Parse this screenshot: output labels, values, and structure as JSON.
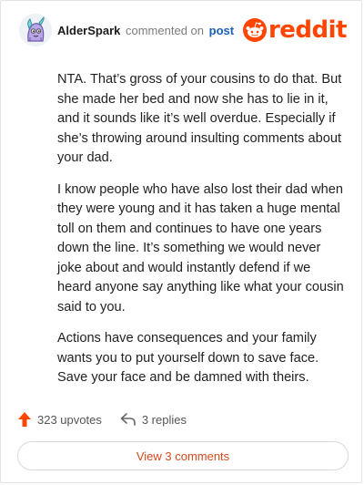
{
  "header": {
    "username": "AlderSpark",
    "action_text": "commented on",
    "post_link": "post",
    "logo_text": "reddit",
    "logo_color": "#ff4500"
  },
  "comment": {
    "paragraphs": [
      "NTA. That’s gross of your cousins to do that. But she made her bed and now she has to lie in it, and it sounds like it’s well overdue. Especially if she’s throwing around insulting comments about your dad.",
      "I know people who have also lost their dad when they were young and it has taken a huge mental toll on them and continues to have one years down the line. It’s something we would never joke about and would instantly defend if we heard anyone say anything like what your cousin said to you.",
      "Actions have consequences and your family wants you to put yourself down to save face. Save your face and be damned with theirs."
    ]
  },
  "actions": {
    "upvotes": "323 upvotes",
    "replies": "3 replies",
    "upvote_icon": "upvote-arrow",
    "reply_icon": "reply-arrow"
  },
  "view_button": {
    "label": "View 3 comments"
  }
}
